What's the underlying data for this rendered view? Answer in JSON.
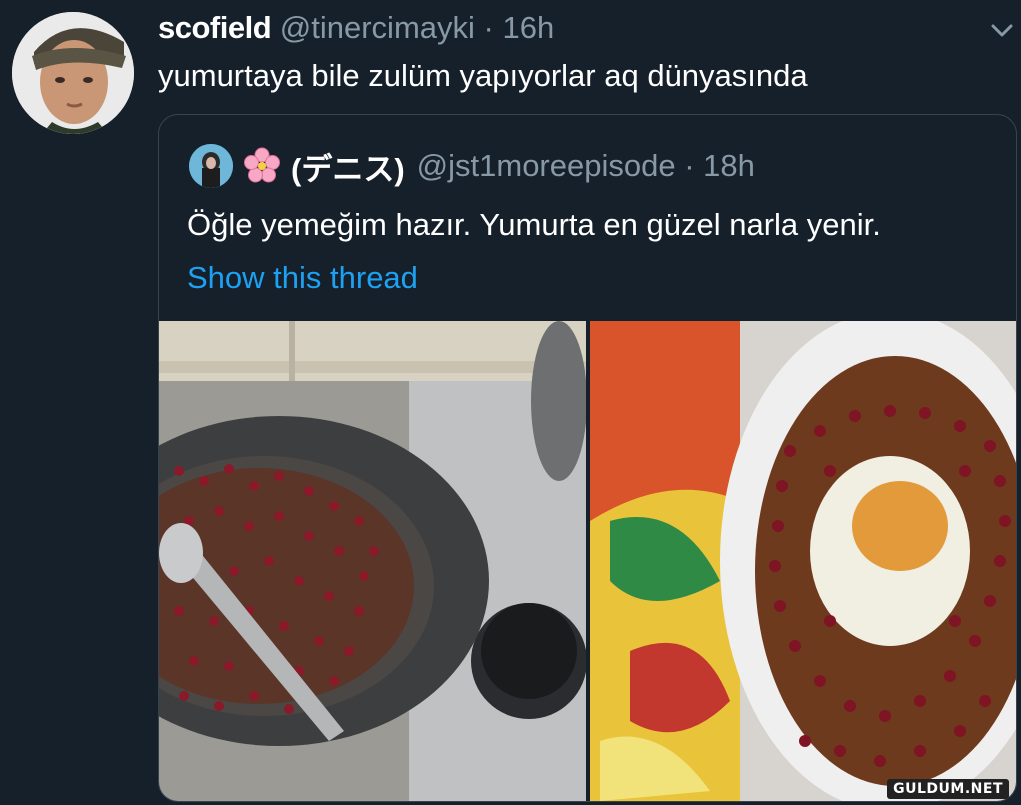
{
  "tweet": {
    "author_name": "scofield",
    "author_handle": "@tinercimayki",
    "separator": "·",
    "time": "16h",
    "text": "yumurtaya bile zulüm yapıyorlar aq dünyasında"
  },
  "quoted_tweet": {
    "author_name": "(デニス)",
    "author_handle": "@jst1moreepisode",
    "separator": "·",
    "time": "18h",
    "text": "Öğle yemeğim hazır. Yumurta en güzel narla yenir.",
    "show_thread_label": "Show this thread"
  },
  "watermark": "GULDUM.NET",
  "colors": {
    "background": "#15202b",
    "link": "#1da1f2",
    "secondary_text": "#8899a6",
    "border": "#38444d"
  },
  "icons": {
    "menu": "chevron-down-icon",
    "flower": "cherry-blossom-icon"
  }
}
